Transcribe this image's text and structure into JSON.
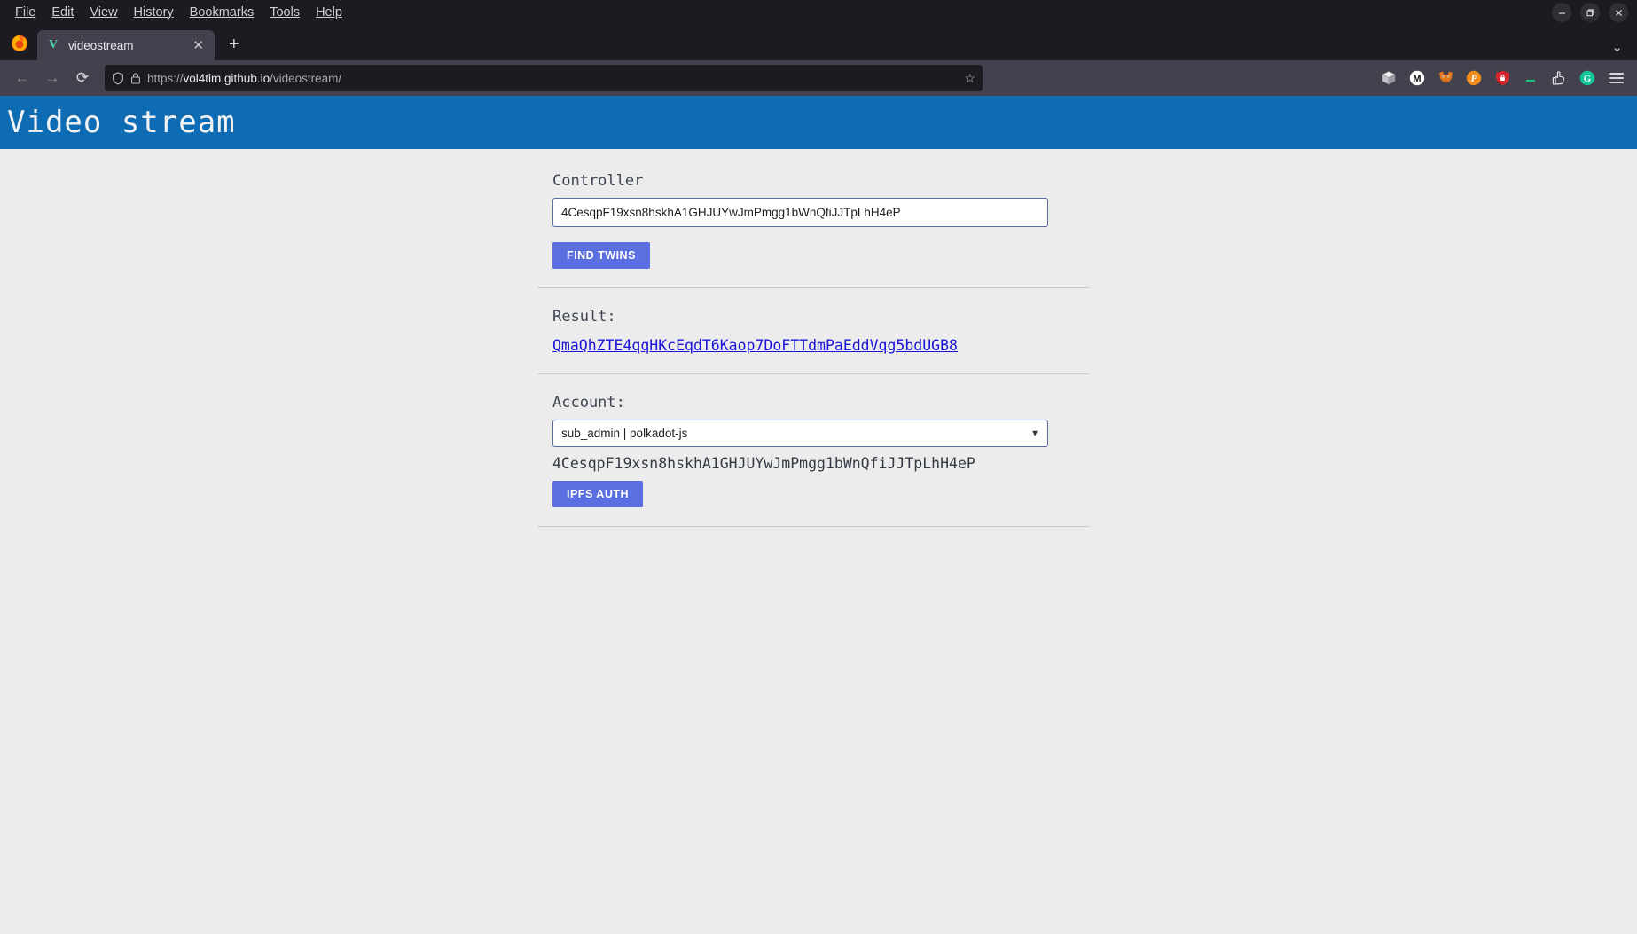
{
  "browser": {
    "menus": [
      "File",
      "Edit",
      "View",
      "History",
      "Bookmarks",
      "Tools",
      "Help"
    ],
    "window_controls": {
      "minimize": "—",
      "restore": "❐",
      "close": "✕"
    },
    "tab": {
      "title": "videostream",
      "favicon_letter": "V",
      "close": "✕"
    },
    "new_tab_label": "+",
    "taglist_chevron": "⌄",
    "nav": {
      "back": "←",
      "forward": "→",
      "reload": "⟳"
    },
    "url": {
      "prefix": "https://",
      "host": "vol4tim.github.io",
      "path": "/videostream/",
      "full": "https://vol4tim.github.io/videostream/"
    },
    "bookmark_star": "☆",
    "extensions": [
      "cube-icon",
      "m-circle-icon",
      "metamask-fox-icon",
      "polkadot-icon",
      "shield-lock-icon",
      "dash-icon",
      "hand-icon",
      "grammarly-icon"
    ],
    "menu_button": "hamburger-icon"
  },
  "page": {
    "title": "Video stream",
    "header_color": "#0d6cb4",
    "accent_button_color": "#5c6fe0",
    "controller": {
      "label": "Controller",
      "value": "4CesqpF19xsn8hskhA1GHJUYwJmPmgg1bWnQfiJJTpLhH4eP",
      "placeholder": "",
      "button_label": "FIND TWINS"
    },
    "result": {
      "label": "Result:",
      "link_text": "QmaQhZTE4qqHKcEqdT6Kaop7DoFTTdmPaEddVqg5bdUGB8"
    },
    "account": {
      "label": "Account:",
      "selected_option": "sub_admin | polkadot-js",
      "options": [
        "sub_admin | polkadot-js"
      ],
      "address": "4CesqpF19xsn8hskhA1GHJUYwJmPmgg1bWnQfiJJTpLhH4eP",
      "button_label": "IPFS AUTH"
    }
  }
}
